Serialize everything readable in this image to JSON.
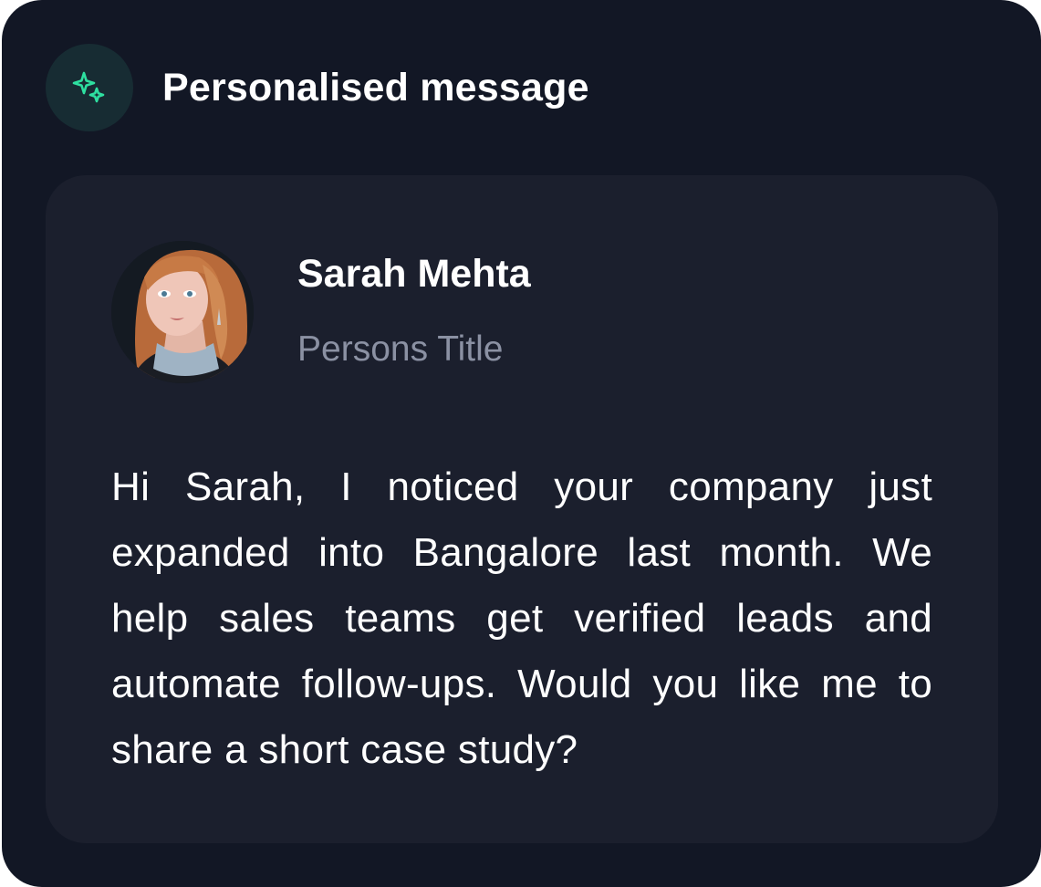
{
  "card": {
    "title": "Personalised message",
    "icon": "sparkles-icon",
    "accent_color": "#2ee0a0"
  },
  "contact": {
    "name": "Sarah Mehta",
    "title": "Persons Title",
    "avatar": "avatar-photo"
  },
  "message": {
    "text": "Hi Sarah, I noticed your company just expanded into Bangalore last month. We help sales teams get verified leads and automate follow-ups. Would you like me to share a short case study?"
  }
}
